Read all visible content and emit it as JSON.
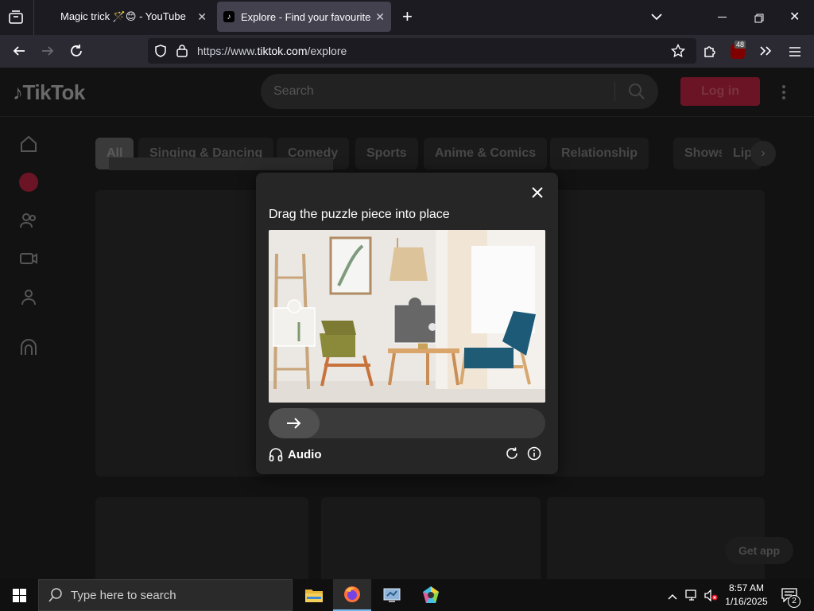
{
  "browser": {
    "tabs": [
      {
        "title": "Magic trick 🪄😊 - YouTube"
      },
      {
        "title": "Explore - Find your favourite vid"
      }
    ],
    "url_prefix": "https://www.",
    "url_host": "tiktok.com",
    "url_path": "/explore",
    "extension_badge": "48"
  },
  "tiktok": {
    "logo_text": "TikTok",
    "search_placeholder": "Search",
    "login_label": "Log in",
    "chips": [
      "All",
      "Singing & Dancing",
      "Comedy",
      "Sports",
      "Anime & Comics",
      "Relationship",
      "Shows",
      "Lip"
    ],
    "get_app_label": "Get app"
  },
  "captcha": {
    "title": "Drag the puzzle piece into place",
    "audio_label": "Audio",
    "slider_progress": 0
  },
  "taskbar": {
    "search_placeholder": "Type here to search",
    "time": "8:57 AM",
    "date": "1/16/2025",
    "notification_count": "2"
  }
}
